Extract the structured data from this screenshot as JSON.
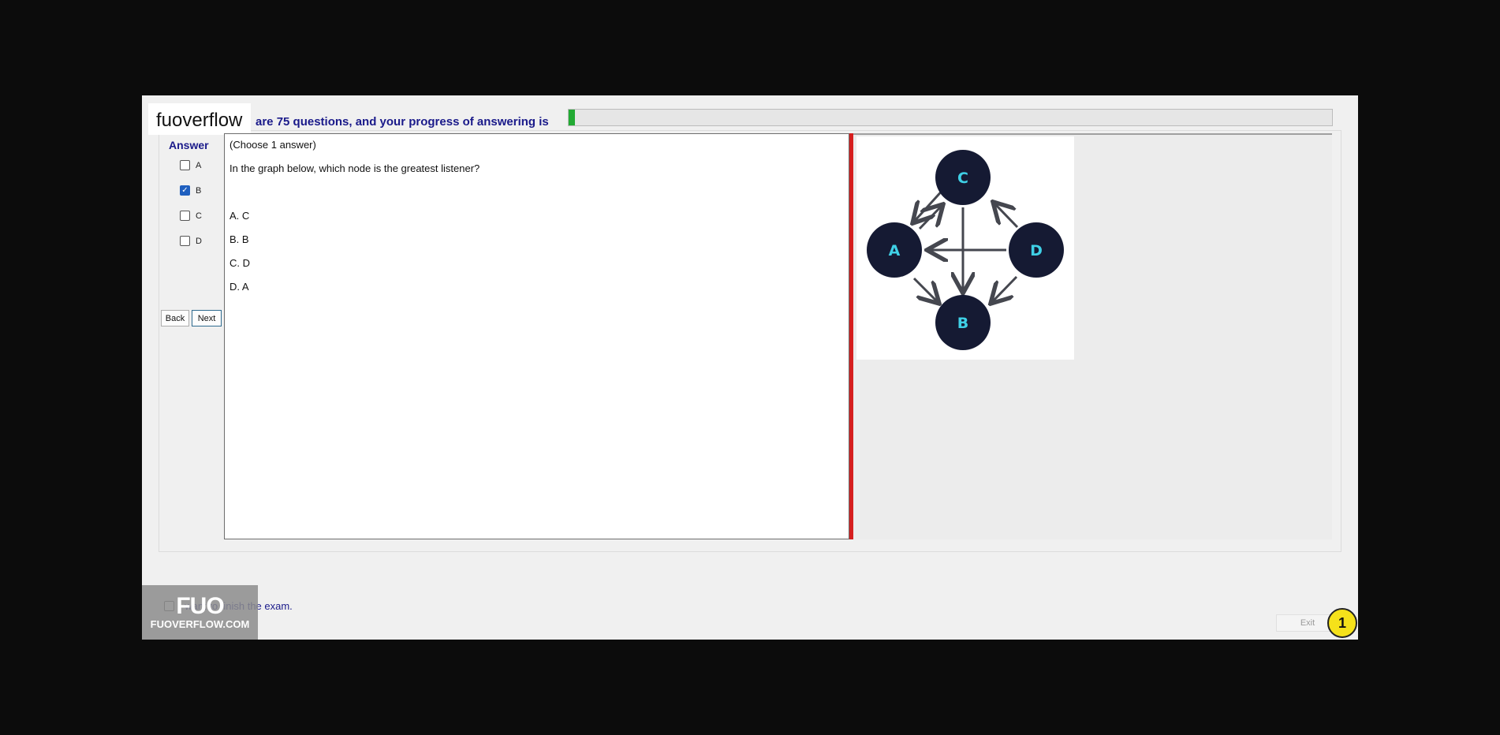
{
  "header": {
    "brand": "fuoverflow",
    "progress_text": "are 75 questions, and your progress of answering is",
    "progress_fraction": 0.008
  },
  "answer_panel": {
    "title": "Answer",
    "options": [
      {
        "label": "A",
        "checked": false
      },
      {
        "label": "B",
        "checked": true
      },
      {
        "label": "C",
        "checked": false
      },
      {
        "label": "D",
        "checked": false
      }
    ],
    "back_label": "Back",
    "next_label": "Next"
  },
  "question": {
    "instruction": "(Choose 1 answer)",
    "text": "In the graph below, which node is the greatest listener?",
    "choices": [
      "A.  C",
      "B.  B",
      "C.  D",
      "D.  A"
    ]
  },
  "graph_image": {
    "nodes": [
      "C",
      "A",
      "D",
      "B"
    ],
    "node_color": "#151a33",
    "label_color": "#3fd0e6"
  },
  "footer": {
    "finish_text": "I want to finish the exam.",
    "logo_big": "FUO",
    "logo_small": "FUOVERFLOW.COM",
    "exit_label": "Exit",
    "page_number": "1"
  }
}
